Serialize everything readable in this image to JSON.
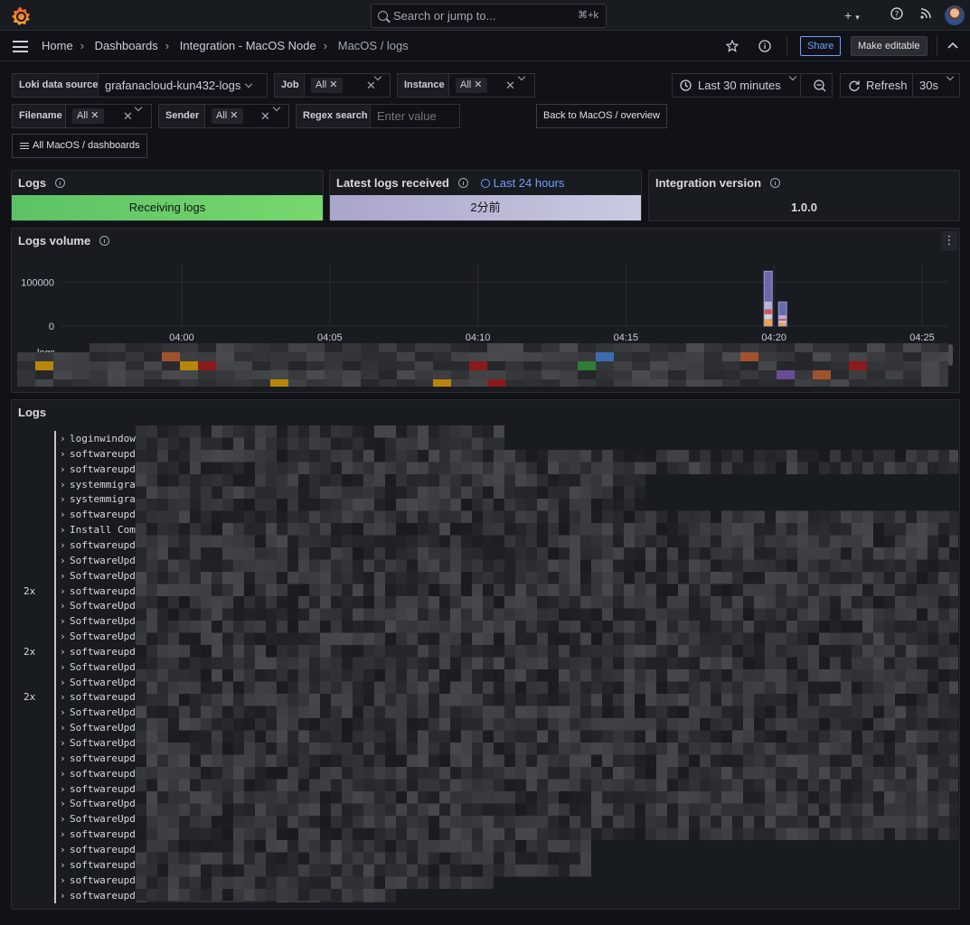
{
  "topbar": {
    "search_placeholder": "Search or jump to...",
    "shortcut": "⌘+k",
    "icons": [
      "plus-icon",
      "help-icon",
      "news-icon"
    ]
  },
  "breadcrumbs": [
    "Home",
    "Dashboards",
    "Integration - MacOS Node",
    "MacOS / logs"
  ],
  "nav": {
    "share": "Share",
    "make_editable": "Make editable"
  },
  "variables": {
    "datasource_label": "Loki data source",
    "datasource_value": "grafanacloud-kun432-logs",
    "job_label": "Job",
    "job_value": "All",
    "instance_label": "Instance",
    "instance_value": "All",
    "filename_label": "Filename",
    "filename_value": "All",
    "sender_label": "Sender",
    "sender_value": "All",
    "regex_label": "Regex search",
    "regex_placeholder": "Enter value",
    "back_link": "Back to MacOS / overview",
    "all_dashboards": "All MacOS / dashboards"
  },
  "time": {
    "range": "Last 30 minutes",
    "refresh": "Refresh",
    "interval": "30s"
  },
  "stats": {
    "logs_title": "Logs",
    "logs_value": "Receiving logs",
    "latest_title": "Latest logs received",
    "latest_range": "Last 24 hours",
    "latest_value": "2分前",
    "version_title": "Integration version",
    "version_value": "1.0.0"
  },
  "volume": {
    "title": "Logs volume",
    "legend": "logs",
    "chart_data": {
      "type": "bar",
      "y_ticks": [
        "100000",
        "0"
      ],
      "x_ticks": [
        "04:00",
        "04:05",
        "04:10",
        "04:15",
        "04:20",
        "04:25"
      ],
      "series": [
        {
          "name": "logs",
          "points": [
            {
              "x": "04:20",
              "y": 125000
            },
            {
              "x": "04:20:30",
              "y": 55000
            }
          ]
        }
      ],
      "ylim": [
        0,
        140000
      ]
    }
  },
  "logs": {
    "title": "Logs",
    "rows": [
      {
        "count": "",
        "text": "loginwindow[15"
      },
      {
        "count": "",
        "text": "softwareupdate"
      },
      {
        "count": "",
        "text": "softwareupdate"
      },
      {
        "count": "",
        "text": "systemmigratio"
      },
      {
        "count": "",
        "text": "systemmigratio"
      },
      {
        "count": "",
        "text": "softwareupdate"
      },
      {
        "count": "",
        "text": "Install Comman"
      },
      {
        "count": "",
        "text": "softwareupdate"
      },
      {
        "count": "",
        "text": "SoftwareUpdate"
      },
      {
        "count": "",
        "text": "SoftwareUpdate"
      },
      {
        "count": "2x",
        "text": "softwareupdate"
      },
      {
        "count": "",
        "text": "SoftwareUpdate"
      },
      {
        "count": "",
        "text": "SoftwareUpdate"
      },
      {
        "count": "",
        "text": "SoftwareUpdate"
      },
      {
        "count": "2x",
        "text": "softwareupdate"
      },
      {
        "count": "",
        "text": "SoftwareUpdate"
      },
      {
        "count": "",
        "text": "SoftwareUpdate"
      },
      {
        "count": "2x",
        "text": "softwareupdate"
      },
      {
        "count": "",
        "text": "SoftwareUpdate"
      },
      {
        "count": "",
        "text": "SoftwareUpdate"
      },
      {
        "count": "",
        "text": "SoftwareUpdate"
      },
      {
        "count": "",
        "text": "softwareupdate"
      },
      {
        "count": "",
        "text": "softwareupdate"
      },
      {
        "count": "",
        "text": "softwareupdate"
      },
      {
        "count": "",
        "text": "SoftwareUpdate"
      },
      {
        "count": "",
        "text": "SoftwareUpdate"
      },
      {
        "count": "",
        "text": "softwareupdate"
      },
      {
        "count": "",
        "text": "softwareupdate"
      },
      {
        "count": "",
        "text": "softwareupdate"
      },
      {
        "count": "",
        "text": "softwareupdate"
      },
      {
        "count": "",
        "text": "softwareupdate"
      }
    ]
  }
}
